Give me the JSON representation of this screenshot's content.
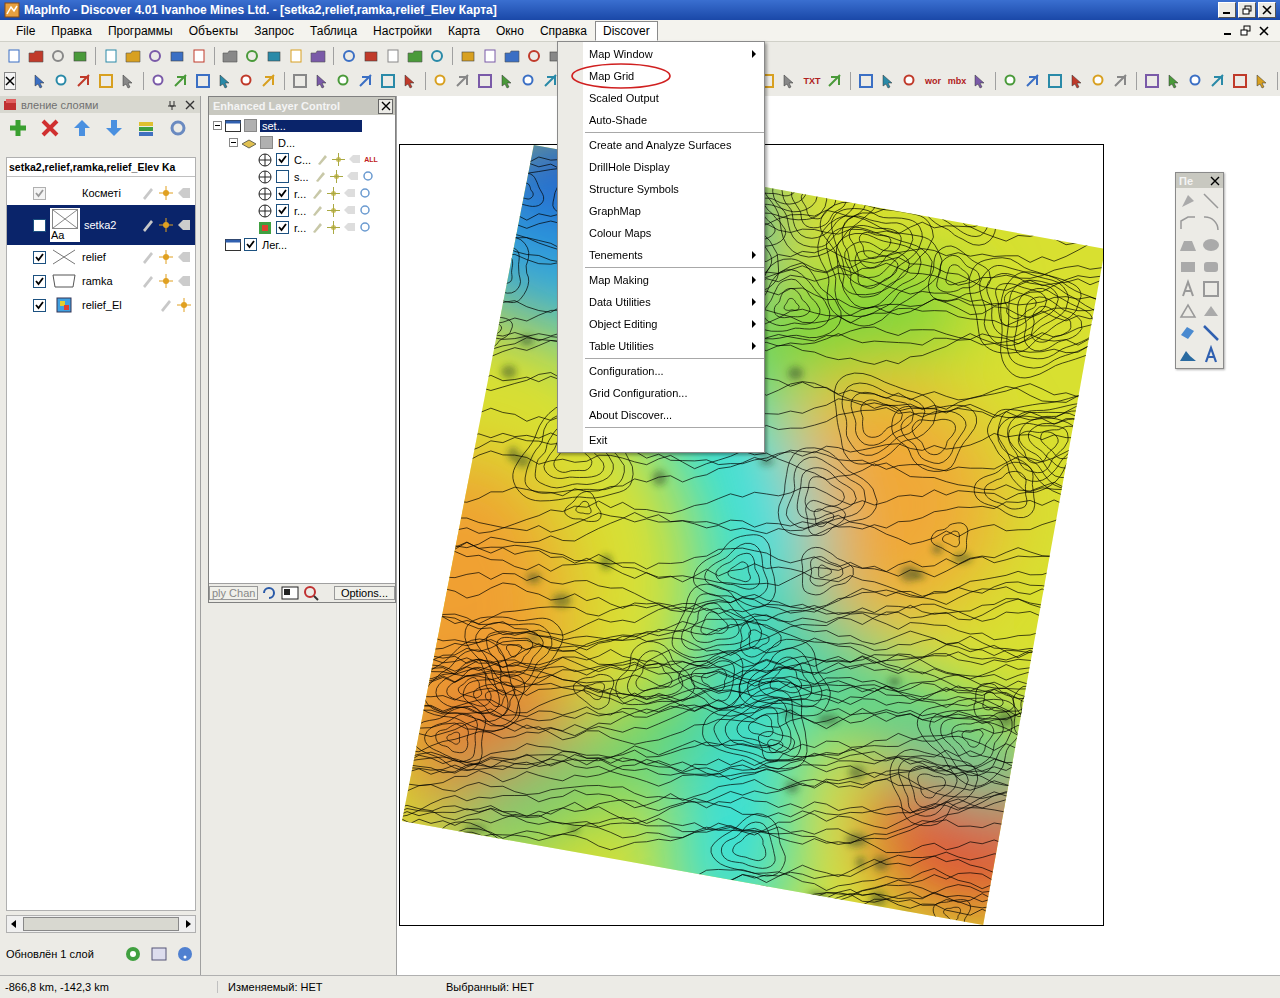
{
  "window": {
    "title": "MapInfo - Discover 4.01   Ivanhoe Mines Ltd. - [setka2,relief,ramka,relief_Elev Карта]"
  },
  "menubar": [
    {
      "label": "File",
      "open": false
    },
    {
      "label": "Правка",
      "open": false
    },
    {
      "label": "Программы",
      "open": false
    },
    {
      "label": "Объекты",
      "open": false
    },
    {
      "label": "Запрос",
      "open": false
    },
    {
      "label": "Таблица",
      "open": false
    },
    {
      "label": "Настройки",
      "open": false
    },
    {
      "label": "Карта",
      "open": false
    },
    {
      "label": "Окно",
      "open": false
    },
    {
      "label": "Справка",
      "open": false
    },
    {
      "label": "Discover",
      "open": true
    }
  ],
  "discover_menu": {
    "items": [
      {
        "kind": "item",
        "label": "Map Window",
        "submenu": true,
        "circled": false
      },
      {
        "kind": "item",
        "label": "Map Grid",
        "submenu": false,
        "circled": true
      },
      {
        "kind": "item",
        "label": "Scaled Output",
        "submenu": false,
        "circled": false
      },
      {
        "kind": "item",
        "label": "Auto-Shade",
        "submenu": false,
        "circled": false
      },
      {
        "kind": "separator",
        "label": "",
        "submenu": false,
        "circled": false
      },
      {
        "kind": "item",
        "label": "Create and Analyze Surfaces",
        "submenu": false,
        "circled": false
      },
      {
        "kind": "item",
        "label": "DrillHole Display",
        "submenu": false,
        "circled": false
      },
      {
        "kind": "item",
        "label": "Structure Symbols",
        "submenu": false,
        "circled": false
      },
      {
        "kind": "item",
        "label": "GraphMap",
        "submenu": false,
        "circled": false
      },
      {
        "kind": "item",
        "label": "Colour Maps",
        "submenu": false,
        "circled": false
      },
      {
        "kind": "item",
        "label": "Tenements",
        "submenu": true,
        "circled": false
      },
      {
        "kind": "separator",
        "label": "",
        "submenu": false,
        "circled": false
      },
      {
        "kind": "item",
        "label": "Map Making",
        "submenu": true,
        "circled": false
      },
      {
        "kind": "item",
        "label": "Data Utilities",
        "submenu": true,
        "circled": false
      },
      {
        "kind": "item",
        "label": "Object Editing",
        "submenu": true,
        "circled": false
      },
      {
        "kind": "item",
        "label": "Table Utilities",
        "submenu": true,
        "circled": false
      },
      {
        "kind": "separator",
        "label": "",
        "submenu": false,
        "circled": false
      },
      {
        "kind": "item",
        "label": "Configuration...",
        "submenu": false,
        "circled": false
      },
      {
        "kind": "item",
        "label": "Grid Configuration...",
        "submenu": false,
        "circled": false
      },
      {
        "kind": "item",
        "label": "About Discover...",
        "submenu": false,
        "circled": false
      },
      {
        "kind": "separator",
        "label": "",
        "submenu": false,
        "circled": false
      },
      {
        "kind": "item",
        "label": "Exit",
        "submenu": false,
        "circled": false
      }
    ]
  },
  "toolbar": {
    "text_buttons": [
      "TXT",
      "wor",
      "mbx"
    ]
  },
  "layer_panel": {
    "title": "вление слоями",
    "map_name": "setka2,relief,ramka,relief_Elev Ka",
    "layers": [
      {
        "name": "Косметі",
        "kind": "cosmetic",
        "visible": true,
        "disabled": true,
        "selected": false,
        "sample": ""
      },
      {
        "name": "setka2",
        "kind": "grid",
        "visible": false,
        "disabled": false,
        "selected": true,
        "sample": "Aa"
      },
      {
        "name": "relief",
        "kind": "line",
        "visible": true,
        "disabled": false,
        "selected": false,
        "sample": ""
      },
      {
        "name": "ramka",
        "kind": "region",
        "visible": true,
        "disabled": false,
        "selected": false,
        "sample": ""
      },
      {
        "name": "relief_El",
        "kind": "raster",
        "visible": true,
        "disabled": false,
        "selected": false,
        "sample": ""
      }
    ],
    "status": "Обновлён 1 слой"
  },
  "elc_panel": {
    "title": "Enhanced Layer Control",
    "nodes": [
      {
        "label": "set...",
        "depth": 0,
        "kind": "map",
        "expandable": true,
        "checked": false,
        "selected": true,
        "badge": ""
      },
      {
        "label": "D...",
        "depth": 1,
        "kind": "group",
        "expandable": true,
        "checked": false,
        "selected": false,
        "badge": ""
      },
      {
        "label": "C...",
        "depth": 2,
        "kind": "layer",
        "expandable": false,
        "checked": true,
        "selected": false,
        "badge": "ALL"
      },
      {
        "label": "s...",
        "depth": 2,
        "kind": "layer",
        "expandable": false,
        "checked": false,
        "selected": false,
        "badge": ""
      },
      {
        "label": "r...",
        "depth": 2,
        "kind": "layer",
        "expandable": false,
        "checked": true,
        "selected": false,
        "badge": ""
      },
      {
        "label": "r...",
        "depth": 2,
        "kind": "layer",
        "expandable": false,
        "checked": true,
        "selected": false,
        "badge": ""
      },
      {
        "label": "r...",
        "depth": 2,
        "kind": "raster",
        "expandable": false,
        "checked": true,
        "selected": false,
        "badge": ""
      },
      {
        "label": "Лег...",
        "depth": 0,
        "kind": "legend",
        "expandable": false,
        "checked": true,
        "selected": false,
        "badge": ""
      }
    ],
    "buttons": [
      "ply Chan",
      "Options..."
    ]
  },
  "palette": {
    "title": "Пе"
  },
  "status_bar": {
    "coords": "-866,8 km, -142,3 km",
    "editable": "Изменяемый: НЕТ",
    "selected": "Выбранный: НЕТ"
  }
}
